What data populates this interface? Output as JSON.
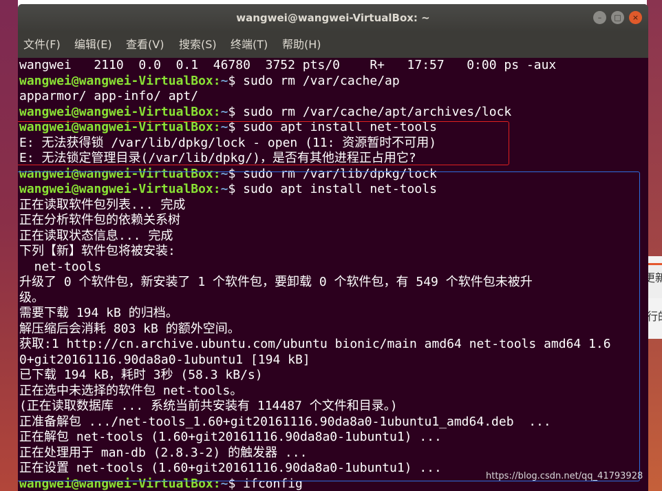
{
  "window": {
    "title": "wangwei@wangwei-VirtualBox: ~",
    "controls": {
      "minimize": "–",
      "maximize": "□",
      "close": "×"
    }
  },
  "menu": [
    "文件(F)",
    "编辑(E)",
    "查看(V)",
    "搜索(S)",
    "终端(T)",
    "帮助(H)"
  ],
  "terminal": {
    "prompt": "wangwei@wangwei-VirtualBox",
    "lines": [
      {
        "type": "out",
        "text": "wangwei   2110  0.0  0.1  46780  3752 pts/0    R+   17:57   0:00 ps -aux"
      },
      {
        "type": "cmd",
        "path": "~",
        "command": "sudo rm /var/cache/ap"
      },
      {
        "type": "out",
        "text": "apparmor/ app-info/ apt/"
      },
      {
        "type": "cmd",
        "path": "~",
        "command": "sudo rm /var/cache/apt/archives/lock"
      },
      {
        "type": "cmd",
        "path": "~",
        "command": "sudo apt install net-tools"
      },
      {
        "type": "out",
        "text": "E: 无法获得锁 /var/lib/dpkg/lock - open (11: 资源暂时不可用)"
      },
      {
        "type": "out",
        "text": "E: 无法锁定管理目录(/var/lib/dpkg/)，是否有其他进程正占用它?"
      },
      {
        "type": "cmd",
        "path": "~",
        "command": "sudo rm /var/lib/dpkg/lock"
      },
      {
        "type": "cmd",
        "path": "~",
        "command": "sudo apt install net-tools"
      },
      {
        "type": "out",
        "text": "正在读取软件包列表... 完成"
      },
      {
        "type": "out",
        "text": "正在分析软件包的依赖关系树"
      },
      {
        "type": "out",
        "text": "正在读取状态信息... 完成"
      },
      {
        "type": "out",
        "text": "下列【新】软件包将被安装:"
      },
      {
        "type": "out",
        "text": "  net-tools"
      },
      {
        "type": "out",
        "text": "升级了 0 个软件包，新安装了 1 个软件包，要卸载 0 个软件包，有 549 个软件包未被升"
      },
      {
        "type": "out",
        "text": "级。"
      },
      {
        "type": "out",
        "text": "需要下载 194 kB 的归档。"
      },
      {
        "type": "out",
        "text": "解压缩后会消耗 803 kB 的额外空间。"
      },
      {
        "type": "out",
        "text": "获取:1 http://cn.archive.ubuntu.com/ubuntu bionic/main amd64 net-tools amd64 1.6"
      },
      {
        "type": "out",
        "text": "0+git20161116.90da8a0-1ubuntu1 [194 kB]"
      },
      {
        "type": "out",
        "text": "已下载 194 kB，耗时 3秒 (58.3 kB/s)"
      },
      {
        "type": "out",
        "text": "正在选中未选择的软件包 net-tools。"
      },
      {
        "type": "out",
        "text": "(正在读取数据库 ... 系统当前共安装有 114487 个文件和目录。)"
      },
      {
        "type": "out",
        "text": "正准备解包 .../net-tools_1.60+git20161116.90da8a0-1ubuntu1_amd64.deb  ..."
      },
      {
        "type": "out",
        "text": "正在解包 net-tools (1.60+git20161116.90da8a0-1ubuntu1) ..."
      },
      {
        "type": "out",
        "text": "正在处理用于 man-db (2.8.3-2) 的触发器 ..."
      },
      {
        "type": "out",
        "text": "正在设置 net-tools (1.60+git20161116.90da8a0-1ubuntu1) ..."
      },
      {
        "type": "cmd",
        "path": "~",
        "command": "ifconfig"
      }
    ]
  },
  "side": {
    "text1": "更新",
    "text2": "行的"
  },
  "watermark": "https://blog.csdn.net/qq_41793928",
  "colors": {
    "terminal_bg": "#2c001e",
    "prompt": "#8ae234",
    "path": "#729fcf",
    "highlight_red": "#e02020",
    "highlight_blue": "#2e6fe0"
  }
}
